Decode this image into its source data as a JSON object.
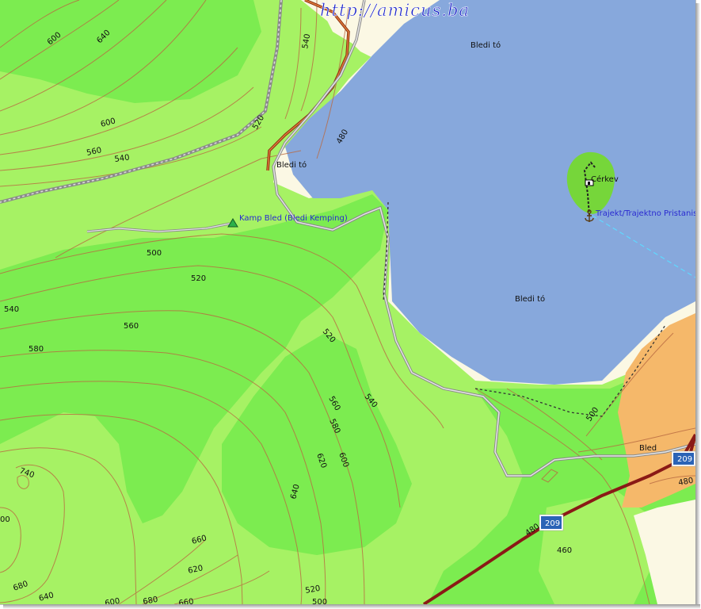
{
  "watermark": "http://amicus.ba",
  "colors": {
    "lake": "#87a8dc",
    "forest_dark": "#7cec50",
    "forest_light": "#a6f264",
    "urban": "#f5b86a",
    "background": "#fbf8e4",
    "contour": "#b96a42",
    "main_road": "#8a1a16"
  },
  "places": {
    "lake_north": "Bledi tó",
    "lake_west": "Bledi tó",
    "lake_center": "Bledi tó",
    "island_church": "Cérkev",
    "ferry": "Trajekt/Trajektno Pristanisce",
    "camp": "Kamp Bled (Bledi Kemping)",
    "town": "Bled"
  },
  "roads": {
    "shield_east": "209",
    "shield_south": "209"
  },
  "contours": {
    "c1": "600",
    "c2": "640",
    "c3": "600",
    "c4": "560",
    "c5": "540",
    "c6": "540",
    "c7": "520",
    "c8": "480",
    "c9": "500",
    "c10": "520",
    "c11": "540",
    "c12": "560",
    "c13": "580",
    "c14": "520",
    "c15": "540",
    "c16": "560",
    "c17": "580",
    "c18": "620",
    "c19": "600",
    "c20": "740",
    "c21": "640",
    "c22": "660",
    "c23": "620",
    "c24": "680",
    "c25": "640",
    "c26": "600",
    "c27": "680",
    "c28": "660",
    "c29": "520",
    "c30": "500",
    "c31": "480",
    "c32": "460",
    "c33": "480",
    "c34": "500",
    "c35": "00"
  },
  "icons": {
    "camp": "tent-icon",
    "church": "church-icon",
    "ferry": "anchor-icon"
  }
}
